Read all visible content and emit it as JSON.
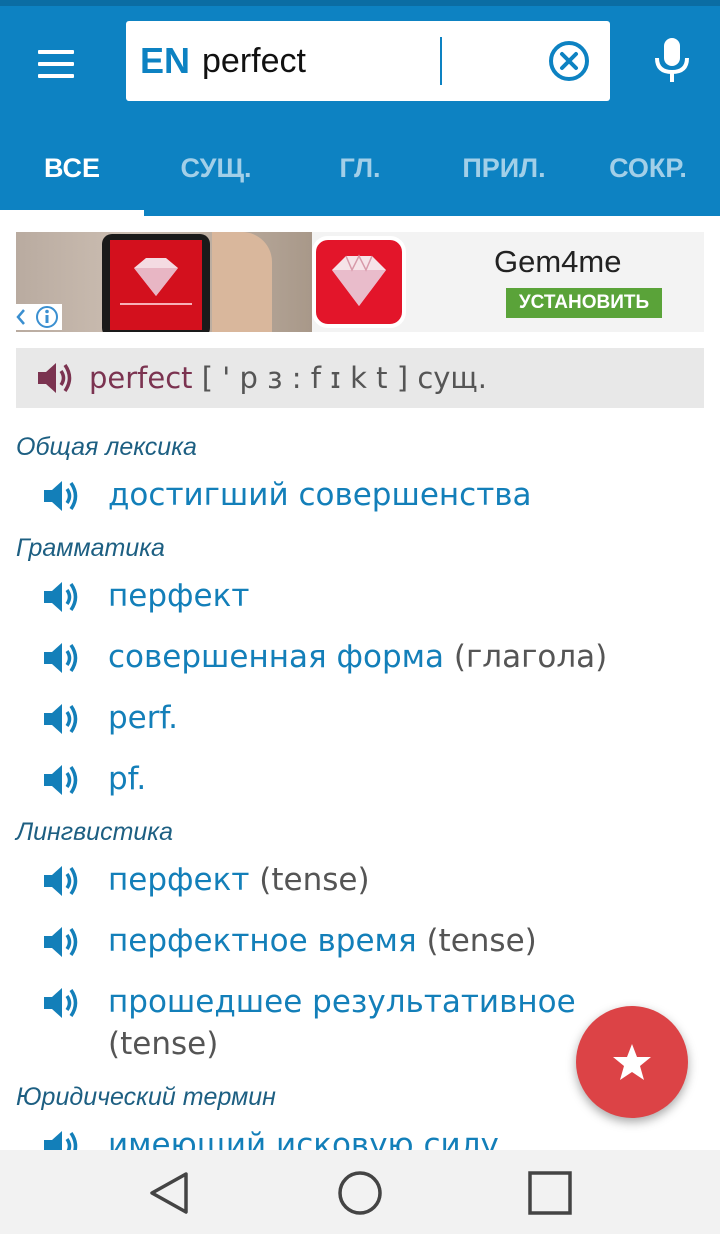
{
  "header": {
    "language": "EN",
    "search_value": "perfect",
    "tabs": [
      {
        "label": "ВСЕ",
        "active": true
      },
      {
        "label": "СУЩ.",
        "active": false
      },
      {
        "label": "ГЛ.",
        "active": false
      },
      {
        "label": "ПРИЛ.",
        "active": false
      },
      {
        "label": "СОКР.",
        "active": false
      }
    ],
    "icons": {
      "menu": "hamburger-menu-icon",
      "clear": "clear-circle-icon",
      "mic": "microphone-icon"
    }
  },
  "ad": {
    "title": "Gem4me",
    "install_label": "УСТАНОВИТЬ",
    "install_color": "#5aa339"
  },
  "headword": {
    "word": "perfect",
    "transcription": "[ ' p ɜ : f ɪ k t ]",
    "pos": "сущ."
  },
  "sections": [
    {
      "category": "Общая лексика",
      "entries": [
        {
          "translation": "достигший совершенства",
          "note": ""
        }
      ]
    },
    {
      "category": "Грамматика",
      "entries": [
        {
          "translation": "перфект",
          "note": ""
        },
        {
          "translation": "совершенная форма",
          "note": "(глагола)"
        },
        {
          "translation": "perf.",
          "note": ""
        },
        {
          "translation": "pf.",
          "note": ""
        }
      ]
    },
    {
      "category": "Лингвистика",
      "entries": [
        {
          "translation": "перфект",
          "note": "(tense)"
        },
        {
          "translation": "перфектное время",
          "note": "(tense)"
        },
        {
          "translation": "прошедшее результативное",
          "note": "(tense)"
        }
      ]
    },
    {
      "category": "Юридический термин",
      "entries": [
        {
          "translation": "имеющий исковую силу",
          "note": ""
        }
      ]
    }
  ],
  "colors": {
    "primary": "#0d82c2",
    "translation": "#137fb9",
    "headword": "#7b3350",
    "category": "#1d5f82",
    "fab": "#dc4346"
  }
}
